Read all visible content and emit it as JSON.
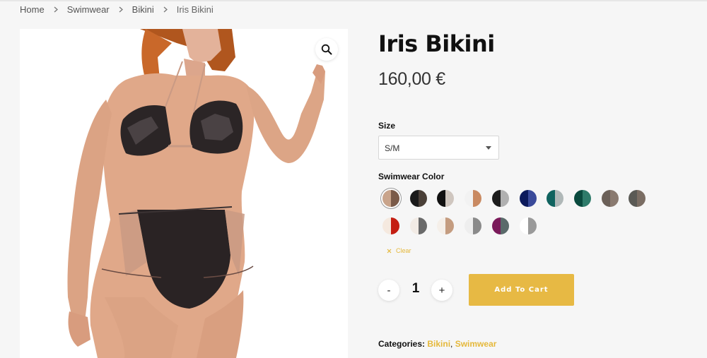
{
  "breadcrumb": {
    "items": [
      "Home",
      "Swimwear",
      "Bikini"
    ],
    "current": "Iris Bikini"
  },
  "gallery": {
    "image_alt": "Model wearing black sequin triangle bikini top and high-waist black and nude bottom",
    "zoom_icon": "search-icon"
  },
  "product": {
    "title": "Iris Bikini",
    "price": "160,00 €"
  },
  "size": {
    "label": "Size",
    "selected": "S/M"
  },
  "swimwear_color": {
    "label": "Swimwear Color",
    "swatches": [
      {
        "colors": [
          "#c9a48b",
          "#7a5a48"
        ],
        "selected": true
      },
      {
        "colors": [
          "#1a1a1a",
          "#4a4038"
        ],
        "selected": false
      },
      {
        "colors": [
          "#111111",
          "#cfc6bf"
        ],
        "selected": false
      },
      {
        "colors": [
          "#f2f2f2",
          "#c98a62"
        ],
        "selected": false
      },
      {
        "colors": [
          "#1c1c1c",
          "#b0b0b0"
        ],
        "selected": false
      },
      {
        "colors": [
          "#0c1a5c",
          "#3a4a9a"
        ],
        "selected": false
      },
      {
        "colors": [
          "#10635f",
          "#b0b8b8"
        ],
        "selected": false
      },
      {
        "colors": [
          "#0a4a3e",
          "#2e7b6a"
        ],
        "selected": false
      },
      {
        "colors": [
          "#6b6058",
          "#8a7a70"
        ],
        "selected": false
      },
      {
        "colors": [
          "#5a5a55",
          "#7a6d63"
        ],
        "selected": false
      },
      {
        "colors": [
          "#f5e9df",
          "#c41e12"
        ],
        "selected": false
      },
      {
        "colors": [
          "#f2ebe5",
          "#6a6a6a"
        ],
        "selected": false
      },
      {
        "colors": [
          "#f5efe9",
          "#c49c80"
        ],
        "selected": false
      },
      {
        "colors": [
          "#eeeeee",
          "#8a8a8a"
        ],
        "selected": false
      },
      {
        "colors": [
          "#7a1a5a",
          "#5a6a6a"
        ],
        "selected": false
      },
      {
        "colors": [
          "#ffffff",
          "#9a9a9a"
        ],
        "selected": false
      }
    ],
    "clear_label": "Clear"
  },
  "quantity": {
    "minus_label": "-",
    "value": "1",
    "plus_label": "+"
  },
  "cart": {
    "add_label": "Add To Cart"
  },
  "categories": {
    "label": "Categories:",
    "items": [
      "Bikini",
      "Swimwear"
    ]
  },
  "colors": {
    "accent": "#e7b944",
    "link": "#e5b83a",
    "background": "#f6f6f6"
  }
}
